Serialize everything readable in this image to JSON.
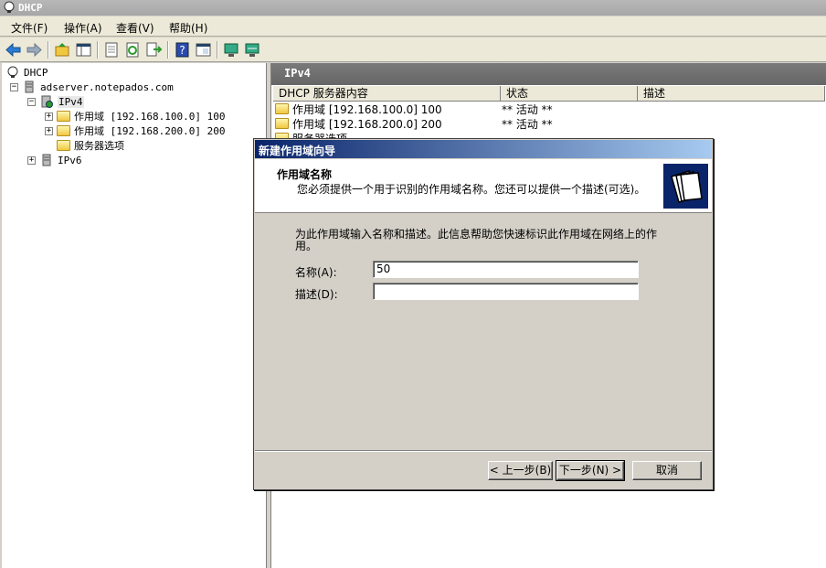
{
  "window": {
    "title": "DHCP"
  },
  "menu": [
    "文件(F)",
    "操作(A)",
    "查看(V)",
    "帮助(H)"
  ],
  "toolbar": [
    "back-icon",
    "forward-icon",
    "up-icon",
    "show-tree-icon",
    "properties-icon",
    "refresh-icon",
    "export-icon",
    "help-icon",
    "console-icon",
    "server-icon",
    "network-icon"
  ],
  "tree": {
    "root": "DHCP",
    "server": "adserver.notepados.com",
    "ipv4": "IPv4",
    "scope1": "作用域 [192.168.100.0] 100",
    "scope2": "作用域 [192.168.200.0] 200",
    "server_options": "服务器选项",
    "ipv6": "IPv6"
  },
  "right": {
    "header": "IPv4",
    "columns": [
      "DHCP 服务器内容",
      "状态",
      "描述"
    ],
    "rows": [
      {
        "name": "作用域 [192.168.100.0] 100",
        "status": "** 活动 **"
      },
      {
        "name": "作用域 [192.168.200.0] 200",
        "status": "** 活动 **"
      },
      {
        "name": "服务器选项",
        "status": ""
      }
    ]
  },
  "dialog": {
    "title": "新建作用域向导",
    "heading": "作用域名称",
    "subheading": "您必须提供一个用于识别的作用域名称。您还可以提供一个描述(可选)。",
    "instructions": "为此作用域输入名称和描述。此信息帮助您快速标识此作用域在网络上的作用。",
    "name_label": "名称(A):",
    "name_value": "50",
    "desc_label": "描述(D):",
    "desc_value": "",
    "back": "< 上一步(B)",
    "next": "下一步(N) >",
    "cancel": "取消"
  },
  "colors": {
    "dialog_title": "#0a246a",
    "pane_header": "#6e6e6e"
  }
}
